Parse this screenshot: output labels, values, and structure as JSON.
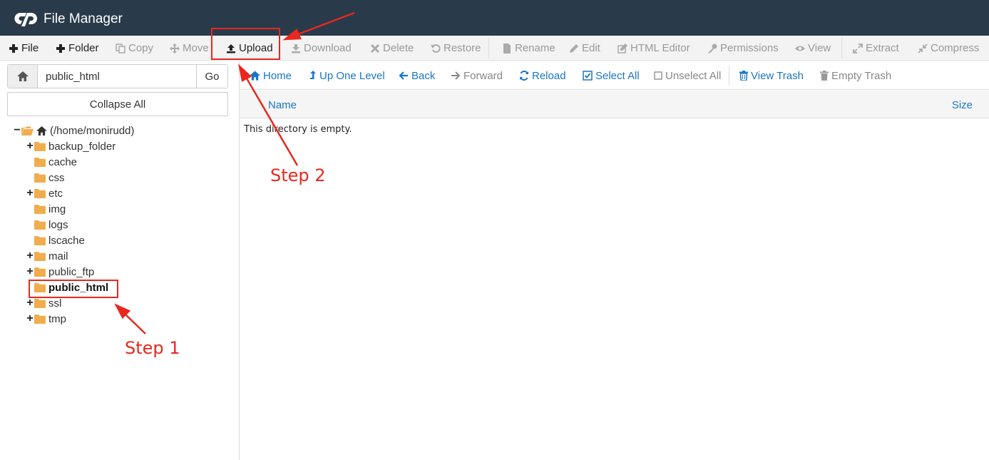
{
  "app": {
    "title": "File Manager"
  },
  "toolbar": {
    "file": "File",
    "folder": "Folder",
    "copy": "Copy",
    "move": "Move",
    "upload": "Upload",
    "download": "Download",
    "delete": "Delete",
    "restore": "Restore",
    "rename": "Rename",
    "edit": "Edit",
    "html_editor": "HTML Editor",
    "permissions": "Permissions",
    "view": "View",
    "extract": "Extract",
    "compress": "Compress"
  },
  "path": {
    "value": "public_html",
    "go": "Go"
  },
  "collapse_all": "Collapse All",
  "tree": {
    "root": "(/home/monirudd)",
    "items": [
      {
        "label": "backup_folder",
        "expandable": true
      },
      {
        "label": "cache",
        "expandable": false
      },
      {
        "label": "css",
        "expandable": false
      },
      {
        "label": "etc",
        "expandable": true
      },
      {
        "label": "img",
        "expandable": false
      },
      {
        "label": "logs",
        "expandable": false
      },
      {
        "label": "lscache",
        "expandable": false
      },
      {
        "label": "mail",
        "expandable": true
      },
      {
        "label": "public_ftp",
        "expandable": true
      },
      {
        "label": "public_html",
        "expandable": false,
        "selected": true
      },
      {
        "label": "ssl",
        "expandable": true
      },
      {
        "label": "tmp",
        "expandable": true
      }
    ]
  },
  "nav": {
    "home": "Home",
    "up_one_level": "Up One Level",
    "back": "Back",
    "forward": "Forward",
    "reload": "Reload",
    "select_all": "Select All",
    "unselect_all": "Unselect All",
    "view_trash": "View Trash",
    "empty_trash": "Empty Trash"
  },
  "table": {
    "col_name": "Name",
    "col_size": "Size",
    "empty_message": "This directory is empty."
  },
  "annotations": {
    "step1": "Step 1",
    "step2": "Step 2"
  },
  "colors": {
    "header": "#293a4a",
    "link": "#1a76c4",
    "folder": "#f0ad4e",
    "annotation": "#e8281e"
  }
}
